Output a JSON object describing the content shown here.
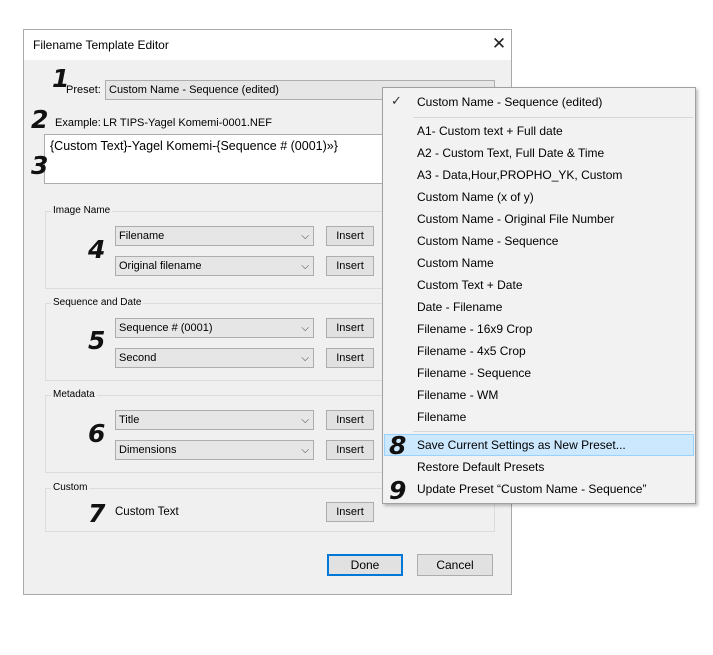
{
  "dialog": {
    "title": "Filename Template Editor",
    "close_glyph": "✕",
    "preset_label": "Preset:",
    "preset_value": "Custom Name - Sequence (edited)",
    "example_label": "Example:",
    "example_value": "LR TIPS-Yagel Komemi-0001.NEF",
    "template_text": "{Custom Text}-Yagel Komemi-{Sequence # (0001)»}",
    "insert_label": "Insert",
    "done_label": "Done",
    "cancel_label": "Cancel",
    "groups": {
      "image_name": {
        "title": "Image Name",
        "combo1": "Filename",
        "combo2": "Original filename"
      },
      "sequence_date": {
        "title": "Sequence and Date",
        "combo1": "Sequence # (0001)",
        "combo2": "Second"
      },
      "metadata": {
        "title": "Metadata",
        "combo1": "Title",
        "combo2": "Dimensions"
      },
      "custom": {
        "title": "Custom",
        "field_label": "Custom Text"
      }
    }
  },
  "steps": [
    "1",
    "2",
    "3",
    "4",
    "5",
    "6",
    "7",
    "8",
    "9"
  ],
  "menu": {
    "check_glyph": "✓",
    "selected_item": "Custom Name - Sequence (edited)",
    "items": [
      "A1- Custom text + Full date",
      "A2 - Custom Text, Full Date & Time",
      "A3 - Data,Hour,PROPHO_YK, Custom",
      "Custom Name (x of y)",
      "Custom Name - Original File Number",
      "Custom Name - Sequence",
      "Custom Name",
      "Custom Text + Date",
      "Date - Filename",
      "Filename - 16x9 Crop",
      "Filename - 4x5 Crop",
      "Filename - Sequence",
      "Filename - WM",
      "Filename"
    ],
    "actions": [
      "Save Current Settings as New Preset...",
      "Restore Default Presets",
      "Update Preset “Custom Name - Sequence”"
    ],
    "highlight_color": "#cce8ff"
  }
}
